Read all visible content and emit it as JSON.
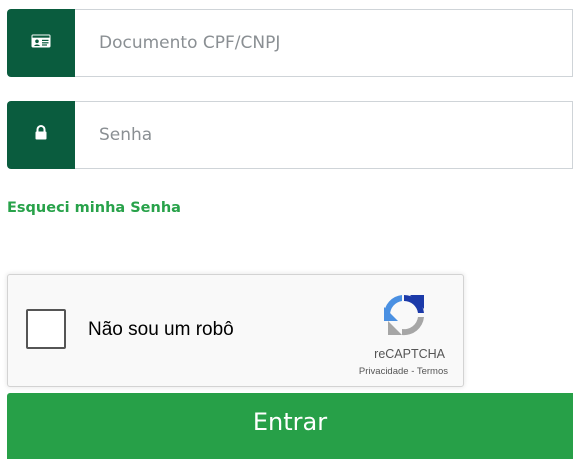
{
  "login": {
    "document_field": {
      "icon": "id-card-icon",
      "placeholder": "Documento CPF/CNPJ",
      "value": ""
    },
    "password_field": {
      "icon": "lock-icon",
      "placeholder": "Senha",
      "value": ""
    },
    "forgot_password_link": "Esqueci minha Senha",
    "submit_label": "Entrar"
  },
  "recaptcha": {
    "checkbox_label": "Não sou um robô",
    "checked": false,
    "brand": "reCAPTCHA",
    "privacy_link": "Privacidade",
    "separator": "-",
    "terms_link": "Termos",
    "icon": "recaptcha-logo-icon"
  },
  "colors": {
    "addon_bg": "#0a5c3e",
    "accent_green": "#28a24a",
    "submit_bg": "#27a048"
  }
}
